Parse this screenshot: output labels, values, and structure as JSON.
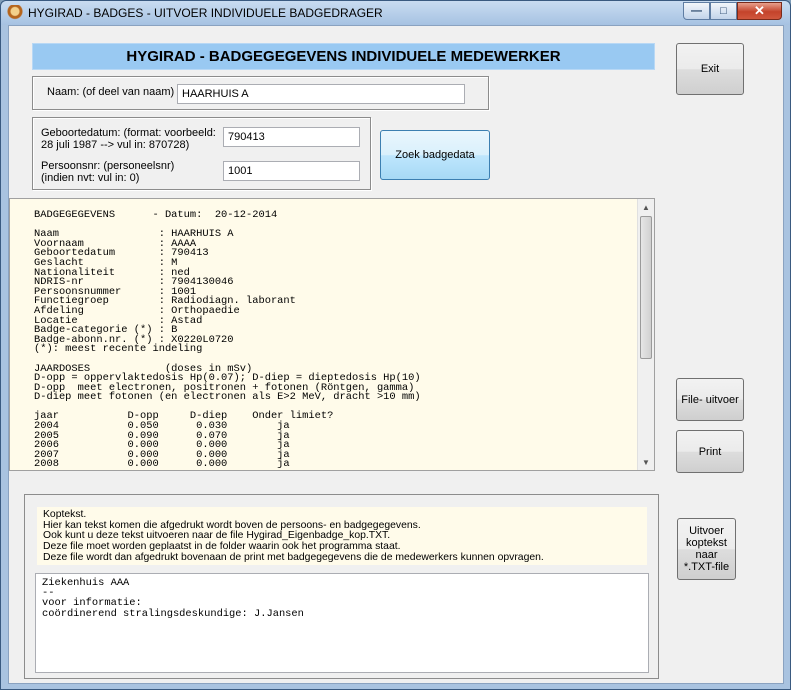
{
  "window": {
    "title": "HYGIRAD - BADGES - UITVOER INDIVIDUELE BADGEDRAGER",
    "minimize": "—",
    "maximize": "□",
    "close": "✕"
  },
  "header": {
    "title": "HYGIRAD - BADGEGEGEVENS INDIVIDUELE MEDEWERKER"
  },
  "search": {
    "name_label": "Naam: (of deel van naam)",
    "name_value": "HAARHUIS A",
    "dob_label_1": "Geboortedatum: (format: voorbeeld:",
    "dob_label_2": "28 juli 1987 --> vul in:   870728)",
    "dob_value": "790413",
    "personnel_label_1": "Persoonsnr: (personeelsnr)",
    "personnel_label_2": "(indien nvt: vul in: 0)",
    "personnel_value": "1001",
    "search_button": "Zoek badgedata"
  },
  "buttons": {
    "exit": "Exit",
    "file_output": "File- uitvoer",
    "print": "Print",
    "export_header_1": "Uitvoer",
    "export_header_2": "koptekst",
    "export_header_3": "naar",
    "export_header_4": "*.TXT-file"
  },
  "output": {
    "lines": [
      "BADGEGEGEVENS      - Datum:  20-12-2014",
      "",
      "Naam                : HAARHUIS A",
      "Voornaam            : AAAA",
      "Geboortedatum       : 790413",
      "Geslacht            : M",
      "Nationaliteit       : ned",
      "NDRIS-nr            : 7904130046",
      "Persoonsnummer      : 1001",
      "Functiegroep        : Radiodiagn. laborant",
      "Afdeling            : Orthopaedie",
      "Locatie             : Astad",
      "Badge-categorie (*) : B",
      "Badge-abonn.nr. (*) : X0220L0720",
      "(*): meest recente indeling",
      "",
      "JAARDOSES            (doses in mSv)",
      "D-opp = oppervlaktedosis Hp(0.07); D-diep = dieptedosis Hp(10)",
      "D-opp  meet electronen, positronen + fotonen (Röntgen, gamma)",
      "D-diep meet fotonen (en electronen als E>2 MeV, dracht >10 mm)",
      "",
      "jaar           D-opp     D-diep    Onder limiet?",
      "2004           0.050      0.030        ja",
      "2005           0.090      0.070        ja",
      "2006           0.000      0.000        ja",
      "2007           0.000      0.000        ja",
      "2008           0.000      0.000        ja"
    ]
  },
  "koptekst": {
    "info_lines": [
      "Koptekst.",
      "Hier kan tekst komen die afgedrukt wordt boven de persoons- en badgegegevens.",
      "Ook kunt u deze tekst uitvoeren naar de file Hygirad_Eigenbadge_kop.TXT.",
      "Deze file moet worden geplaatst in de folder waarin ook het programma staat.",
      "Deze file wordt dan afgedrukt bovenaan de print met badgegegevens die de medewerkers kunnen opvragen."
    ],
    "edit_lines": [
      "Ziekenhuis AAA",
      "--",
      "voor informatie:",
      "coördinerend stralingsdeskundige: J.Jansen"
    ]
  },
  "icons": {
    "app": "radiation-badge-icon",
    "scroll_up": "▲",
    "scroll_down": "▼"
  }
}
